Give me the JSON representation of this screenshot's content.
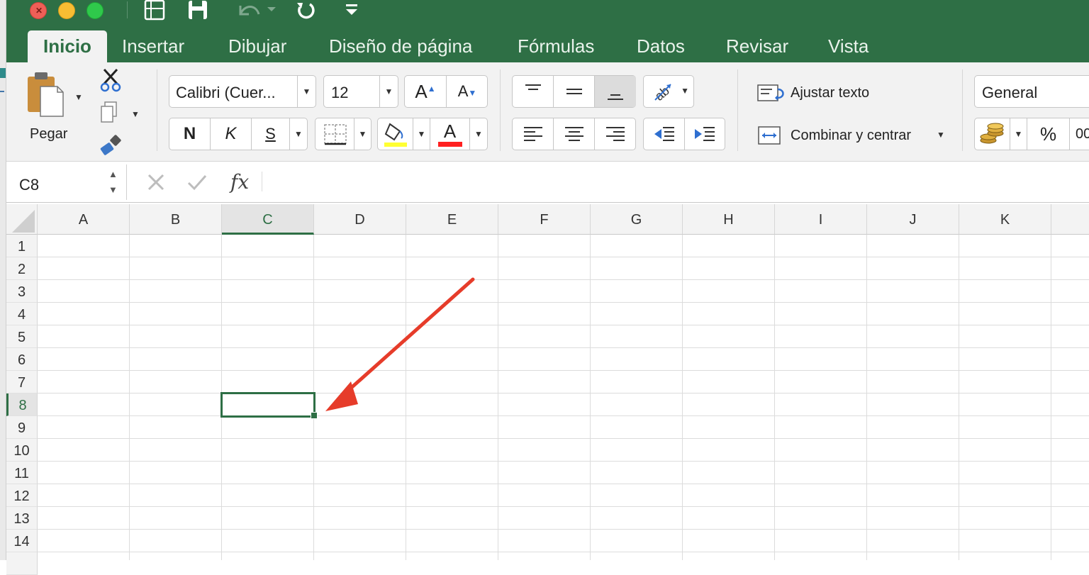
{
  "quick_access": {
    "icons": [
      "sheet-icon",
      "save-icon",
      "undo-icon",
      "redo-icon",
      "customize-icon"
    ]
  },
  "tabs": [
    {
      "label": "Inicio",
      "active": true
    },
    {
      "label": "Insertar"
    },
    {
      "label": "Dibujar"
    },
    {
      "label": "Diseño de página"
    },
    {
      "label": "Fórmulas"
    },
    {
      "label": "Datos"
    },
    {
      "label": "Revisar"
    },
    {
      "label": "Vista"
    }
  ],
  "clipboard": {
    "paste_label": "Pegar"
  },
  "font": {
    "name": "Calibri (Cuer...",
    "size": "12",
    "grow_label": "A",
    "shrink_label": "A",
    "bold": "N",
    "italic": "K",
    "underline": "S",
    "color_letter": "A",
    "highlight_color": "#ffff33",
    "font_color": "#ff2020"
  },
  "alignment": {
    "wrap_label": "Ajustar texto",
    "merge_label": "Combinar y centrar"
  },
  "number": {
    "format": "General",
    "percent": "%",
    "comma": "00"
  },
  "formula_bar": {
    "cell_ref": "C8",
    "fx": "fx",
    "value": ""
  },
  "sheet": {
    "columns": [
      "A",
      "B",
      "C",
      "D",
      "E",
      "F",
      "G",
      "H",
      "I",
      "J",
      "K"
    ],
    "rows": [
      "1",
      "2",
      "3",
      "4",
      "5",
      "6",
      "7",
      "8",
      "9",
      "10",
      "11",
      "12",
      "13",
      "14"
    ],
    "selected_column": "C",
    "selected_row": "8"
  },
  "colors": {
    "brand_green": "#2e6f45",
    "annotation_arrow": "#e63c2a"
  }
}
